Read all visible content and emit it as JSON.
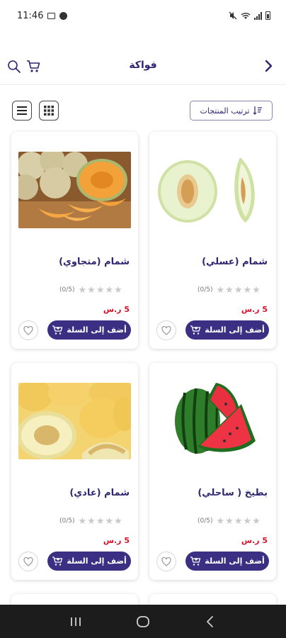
{
  "status_bar": {
    "time": "11:46"
  },
  "header": {
    "title": "فواكة"
  },
  "toolbar": {
    "sort_label": "ترتيب المنتجات"
  },
  "products": [
    {
      "name": "شمام (عسلي)",
      "rating_text": "(0/5)",
      "price": "5 ر.س",
      "add_label": "أضف إلى السلة"
    },
    {
      "name": "شمام (متجاوي)",
      "rating_text": "(0/5)",
      "price": "5 ر.س",
      "add_label": "أضف إلى السلة"
    },
    {
      "name": "بطيخ ( ساحلي)",
      "rating_text": "(0/5)",
      "price": "5 ر.س",
      "add_label": "أضف إلى السلة"
    },
    {
      "name": "شمام (عادي)",
      "rating_text": "(0/5)",
      "price": "5 ر.س",
      "add_label": "أضف إلى السلة"
    }
  ],
  "colors": {
    "primary": "#3b2f84",
    "title": "#2d2670",
    "price": "#d8122a",
    "star": "#c9c9c9"
  }
}
